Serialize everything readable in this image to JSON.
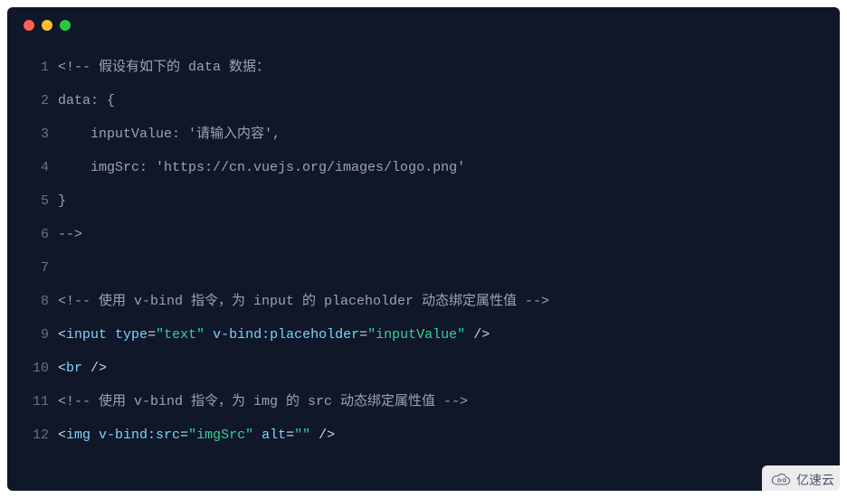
{
  "titlebar": {
    "dots": [
      "red",
      "yellow",
      "green"
    ]
  },
  "code": {
    "lines": [
      {
        "n": "1",
        "tokens": [
          {
            "t": "comment",
            "v": "<!-- 假设有如下的 data 数据："
          }
        ]
      },
      {
        "n": "2",
        "tokens": [
          {
            "t": "comment",
            "v": "data: {"
          }
        ]
      },
      {
        "n": "3",
        "tokens": [
          {
            "t": "comment",
            "v": "    inputValue: '请输入内容',"
          }
        ]
      },
      {
        "n": "4",
        "tokens": [
          {
            "t": "comment",
            "v": "    imgSrc: 'https://cn.vuejs.org/images/logo.png'"
          }
        ]
      },
      {
        "n": "5",
        "tokens": [
          {
            "t": "comment",
            "v": "}"
          }
        ]
      },
      {
        "n": "6",
        "tokens": [
          {
            "t": "comment",
            "v": "-->"
          }
        ]
      },
      {
        "n": "7",
        "tokens": []
      },
      {
        "n": "8",
        "tokens": [
          {
            "t": "comment",
            "v": "<!-- 使用 v-bind 指令，为 input 的 placeholder 动态绑定属性值 -->"
          }
        ]
      },
      {
        "n": "9",
        "tokens": [
          {
            "t": "punc",
            "v": "<"
          },
          {
            "t": "tag",
            "v": "input"
          },
          {
            "t": "punc",
            "v": " "
          },
          {
            "t": "attr",
            "v": "type"
          },
          {
            "t": "eq",
            "v": "="
          },
          {
            "t": "string",
            "v": "\"text\""
          },
          {
            "t": "punc",
            "v": " "
          },
          {
            "t": "attr",
            "v": "v-bind:placeholder"
          },
          {
            "t": "eq",
            "v": "="
          },
          {
            "t": "string",
            "v": "\"inputValue\""
          },
          {
            "t": "punc",
            "v": " />"
          }
        ]
      },
      {
        "n": "10",
        "tokens": [
          {
            "t": "punc",
            "v": "<"
          },
          {
            "t": "tag",
            "v": "br"
          },
          {
            "t": "punc",
            "v": " />"
          }
        ]
      },
      {
        "n": "11",
        "tokens": [
          {
            "t": "comment",
            "v": "<!-- 使用 v-bind 指令，为 img 的 src 动态绑定属性值 -->"
          }
        ]
      },
      {
        "n": "12",
        "tokens": [
          {
            "t": "punc",
            "v": "<"
          },
          {
            "t": "tag",
            "v": "img"
          },
          {
            "t": "punc",
            "v": " "
          },
          {
            "t": "attr",
            "v": "v-bind:src"
          },
          {
            "t": "eq",
            "v": "="
          },
          {
            "t": "string",
            "v": "\"imgSrc\""
          },
          {
            "t": "punc",
            "v": " "
          },
          {
            "t": "attr",
            "v": "alt"
          },
          {
            "t": "eq",
            "v": "="
          },
          {
            "t": "string",
            "v": "\"\""
          },
          {
            "t": "punc",
            "v": " />"
          }
        ]
      }
    ]
  },
  "watermark": {
    "text": "亿速云"
  }
}
